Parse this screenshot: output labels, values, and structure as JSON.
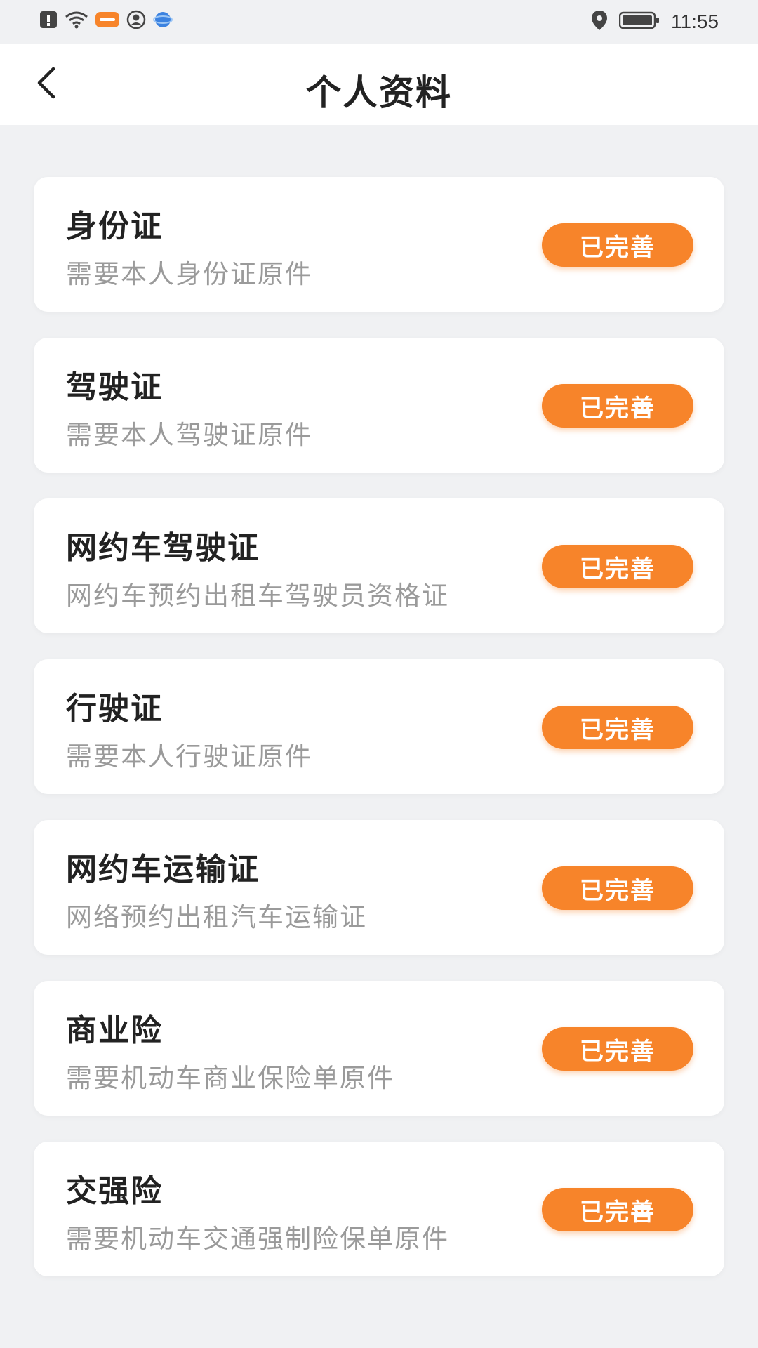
{
  "status_bar": {
    "time": "11:55",
    "icons": [
      "notification-icon",
      "wifi-icon",
      "app-badge-icon",
      "user-icon",
      "browser-icon",
      "location-icon",
      "battery-icon"
    ]
  },
  "header": {
    "title": "个人资料",
    "back_icon": "chevron-left-icon"
  },
  "theme": {
    "accent": "#f7842a",
    "background": "#f0f1f3"
  },
  "items": [
    {
      "title": "身份证",
      "subtitle": "需要本人身份证原件",
      "status": "已完善"
    },
    {
      "title": "驾驶证",
      "subtitle": "需要本人驾驶证原件",
      "status": "已完善"
    },
    {
      "title": "网约车驾驶证",
      "subtitle": "网约车预约出租车驾驶员资格证",
      "status": "已完善"
    },
    {
      "title": "行驶证",
      "subtitle": "需要本人行驶证原件",
      "status": "已完善"
    },
    {
      "title": "网约车运输证",
      "subtitle": "网络预约出租汽车运输证",
      "status": "已完善"
    },
    {
      "title": "商业险",
      "subtitle": "需要机动车商业保险单原件",
      "status": "已完善"
    },
    {
      "title": "交强险",
      "subtitle": "需要机动车交通强制险保单原件",
      "status": "已完善"
    }
  ]
}
